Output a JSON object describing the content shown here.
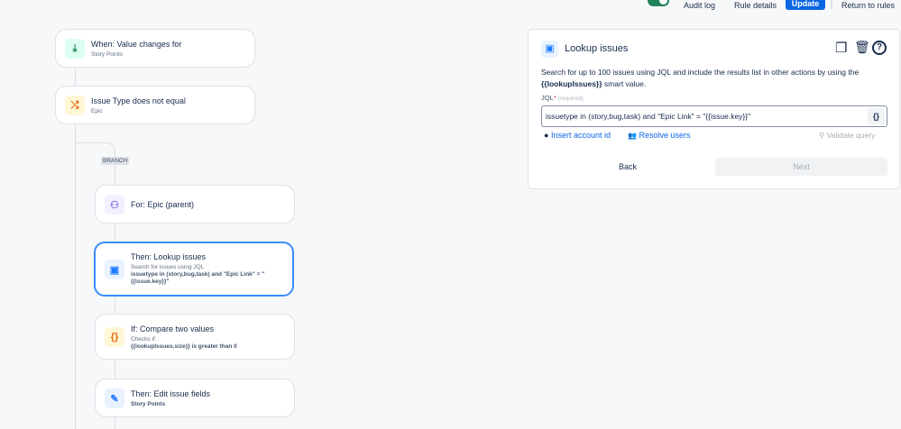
{
  "topbar": {
    "audit_log": "Audit log",
    "rule_details": "Rule details",
    "update": "Update",
    "return": "Return to rules",
    "toggle_enabled": true
  },
  "flow": {
    "branch_label": "BRANCH",
    "cards": [
      {
        "title": "When: Value changes for",
        "subtitle": "Story Points",
        "icon": "trigger-icon"
      },
      {
        "title": "Issue Type does not equal",
        "subtitle": "Epic",
        "icon": "shuffle-icon"
      },
      {
        "title": "For: Epic (parent)",
        "icon": "hierarchy-icon"
      },
      {
        "title": "Then: Lookup issues",
        "subtitle": "Search for issues using JQL",
        "detail": "issuetype in (story,bug,task) and \"Epic Link\" = \"{{issue.key}}\"",
        "icon": "lookup-icon"
      },
      {
        "title": "If: Compare two values",
        "subtitle": "Checks if:",
        "detail": "{{lookupIssues.size}} is greater than 0",
        "icon": "braces-icon"
      },
      {
        "title": "Then: Edit issue fields",
        "detail": "Story Points",
        "icon": "pencil-icon"
      }
    ]
  },
  "panel": {
    "title": "Lookup issues",
    "desc1": "Search for up to 100 issues using JQL and include the results list in other actions by using the",
    "desc_bold": "{{lookupIssues}}",
    "desc2": " smart value.",
    "jql_label": "JQL",
    "required_star": "*",
    "required": "(required)",
    "jql_value": "issuetype in (story,bug,task) and \"Epic Link\" = \"{{issue.key}}\"",
    "braces": "{}",
    "insert_account": "Insert account id",
    "resolve_users": "Resolve users",
    "validate": "Validate query",
    "back": "Back",
    "next": "Next"
  }
}
